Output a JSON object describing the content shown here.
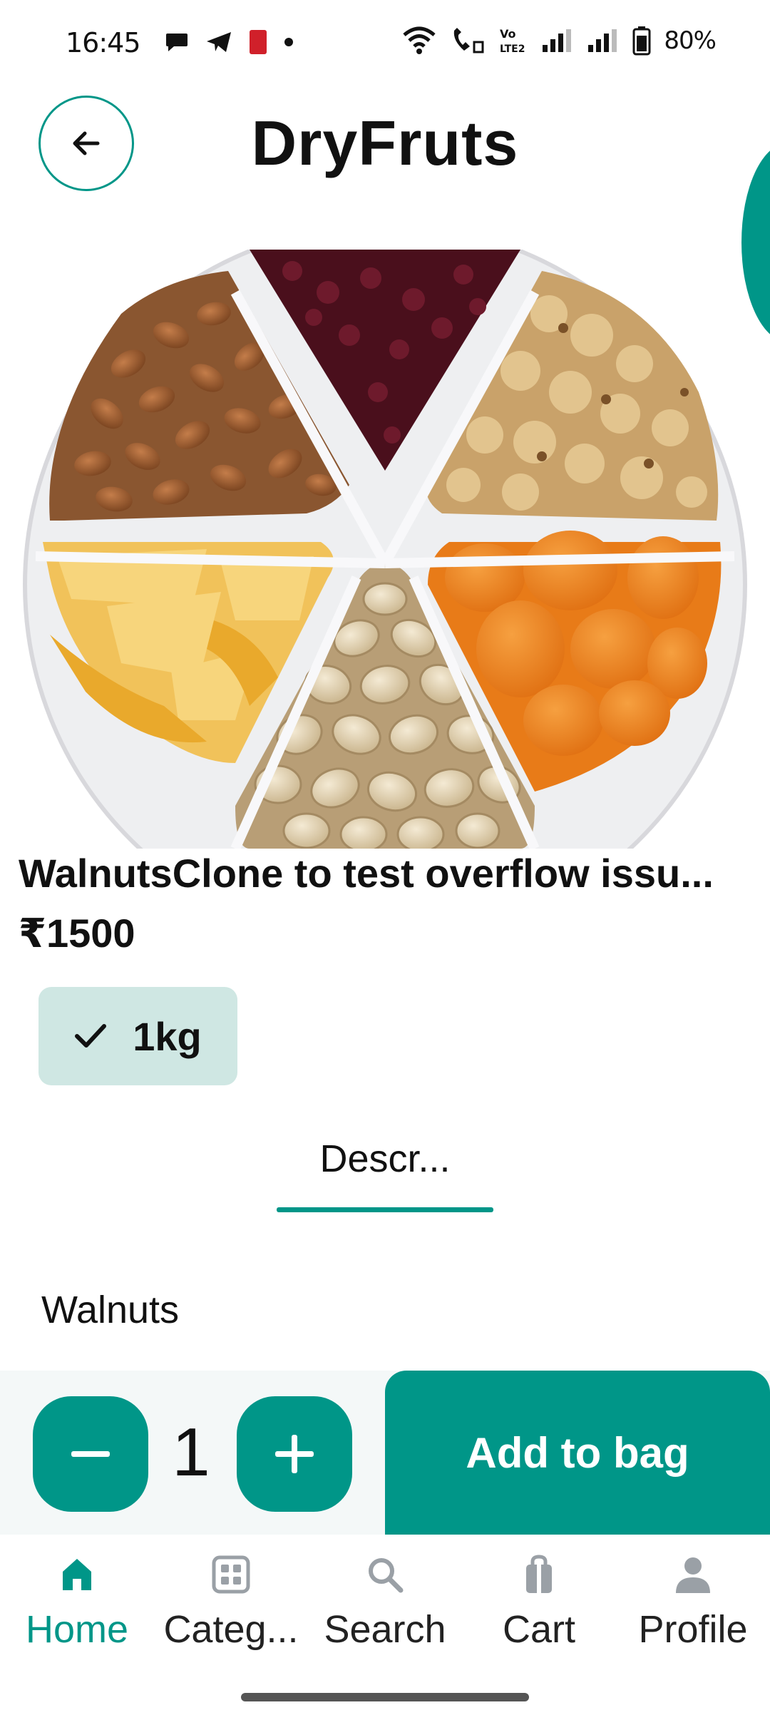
{
  "status_bar": {
    "time": "16:45",
    "battery": "80%",
    "icons": [
      "chat-icon",
      "telegram-icon",
      "app-icon",
      "dot-icon",
      "wifi-icon",
      "wifi-call-icon",
      "volte-icon",
      "signal-icon",
      "signal-icon",
      "battery-icon"
    ]
  },
  "header": {
    "title": "DryFruts",
    "back_icon": "arrow-left-icon"
  },
  "product": {
    "name": "WalnutsClone to test overflow issu...",
    "price": "₹1500",
    "variant": {
      "label": "1kg",
      "selected": true,
      "icon": "check-icon"
    },
    "tab": "Descr...",
    "description": "Walnuts"
  },
  "actions": {
    "quantity": "1",
    "minus_icon": "minus-icon",
    "plus_icon": "plus-icon",
    "add_to_bag": "Add to bag"
  },
  "nav": {
    "items": [
      {
        "label": "Home",
        "icon": "home-icon",
        "active": true
      },
      {
        "label": "Categ...",
        "icon": "grid-icon",
        "active": false
      },
      {
        "label": "Search",
        "icon": "search-icon",
        "active": false
      },
      {
        "label": "Cart",
        "icon": "bag-icon",
        "active": false
      },
      {
        "label": "Profile",
        "icon": "person-icon",
        "active": false
      }
    ]
  },
  "colors": {
    "accent": "#009688",
    "chip_bg": "#cfe7e3",
    "action_bar_bg": "#f4f8f8"
  }
}
